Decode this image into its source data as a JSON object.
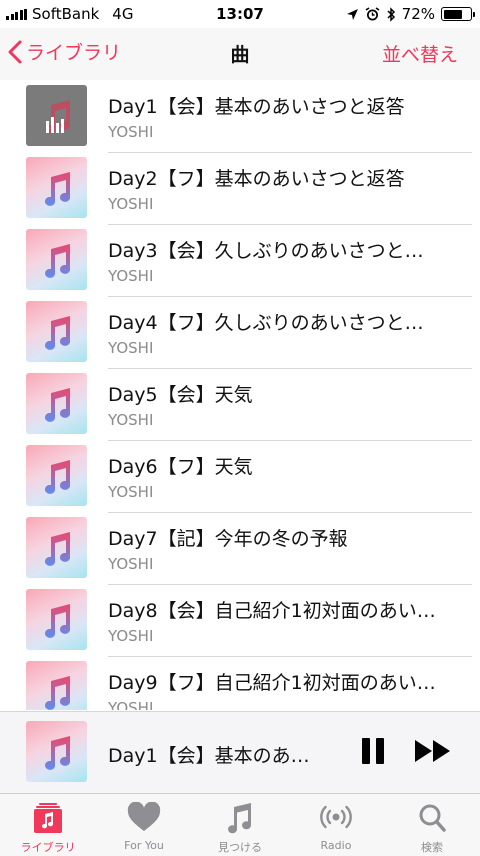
{
  "status_bar": {
    "carrier": "SoftBank",
    "network": "4G",
    "time": "13:07",
    "battery": "72%",
    "battery_level": 0.72
  },
  "nav": {
    "back_label": "ライブラリ",
    "title": "曲",
    "action_label": "並べ替え"
  },
  "songs": [
    {
      "title": "Day1【会】基本のあいさつと返答",
      "artist": "YOSHI",
      "playing": true
    },
    {
      "title": "Day2【フ】基本のあいさつと返答",
      "artist": "YOSHI"
    },
    {
      "title": "Day3【会】久しぶりのあいさつと…",
      "artist": "YOSHI"
    },
    {
      "title": "Day4【フ】久しぶりのあいさつと…",
      "artist": "YOSHI"
    },
    {
      "title": "Day5【会】天気",
      "artist": "YOSHI"
    },
    {
      "title": "Day6【フ】天気",
      "artist": "YOSHI"
    },
    {
      "title": "Day7【記】今年の冬の予報",
      "artist": "YOSHI"
    },
    {
      "title": "Day8【会】自己紹介1初対面のあい…",
      "artist": "YOSHI"
    },
    {
      "title": "Day9【フ】自己紹介1初対面のあい…",
      "artist": "YOSHI"
    }
  ],
  "mini_player": {
    "title": "Day1【会】基本のあ…"
  },
  "tabs": [
    {
      "label": "ライブラリ",
      "icon": "library-icon",
      "active": true
    },
    {
      "label": "For You",
      "icon": "heart-icon"
    },
    {
      "label": "見つける",
      "icon": "music-note-icon"
    },
    {
      "label": "Radio",
      "icon": "radio-icon"
    },
    {
      "label": "検索",
      "icon": "search-icon"
    }
  ],
  "colors": {
    "accent": "#f0395a",
    "inactive": "#8e8e93"
  }
}
